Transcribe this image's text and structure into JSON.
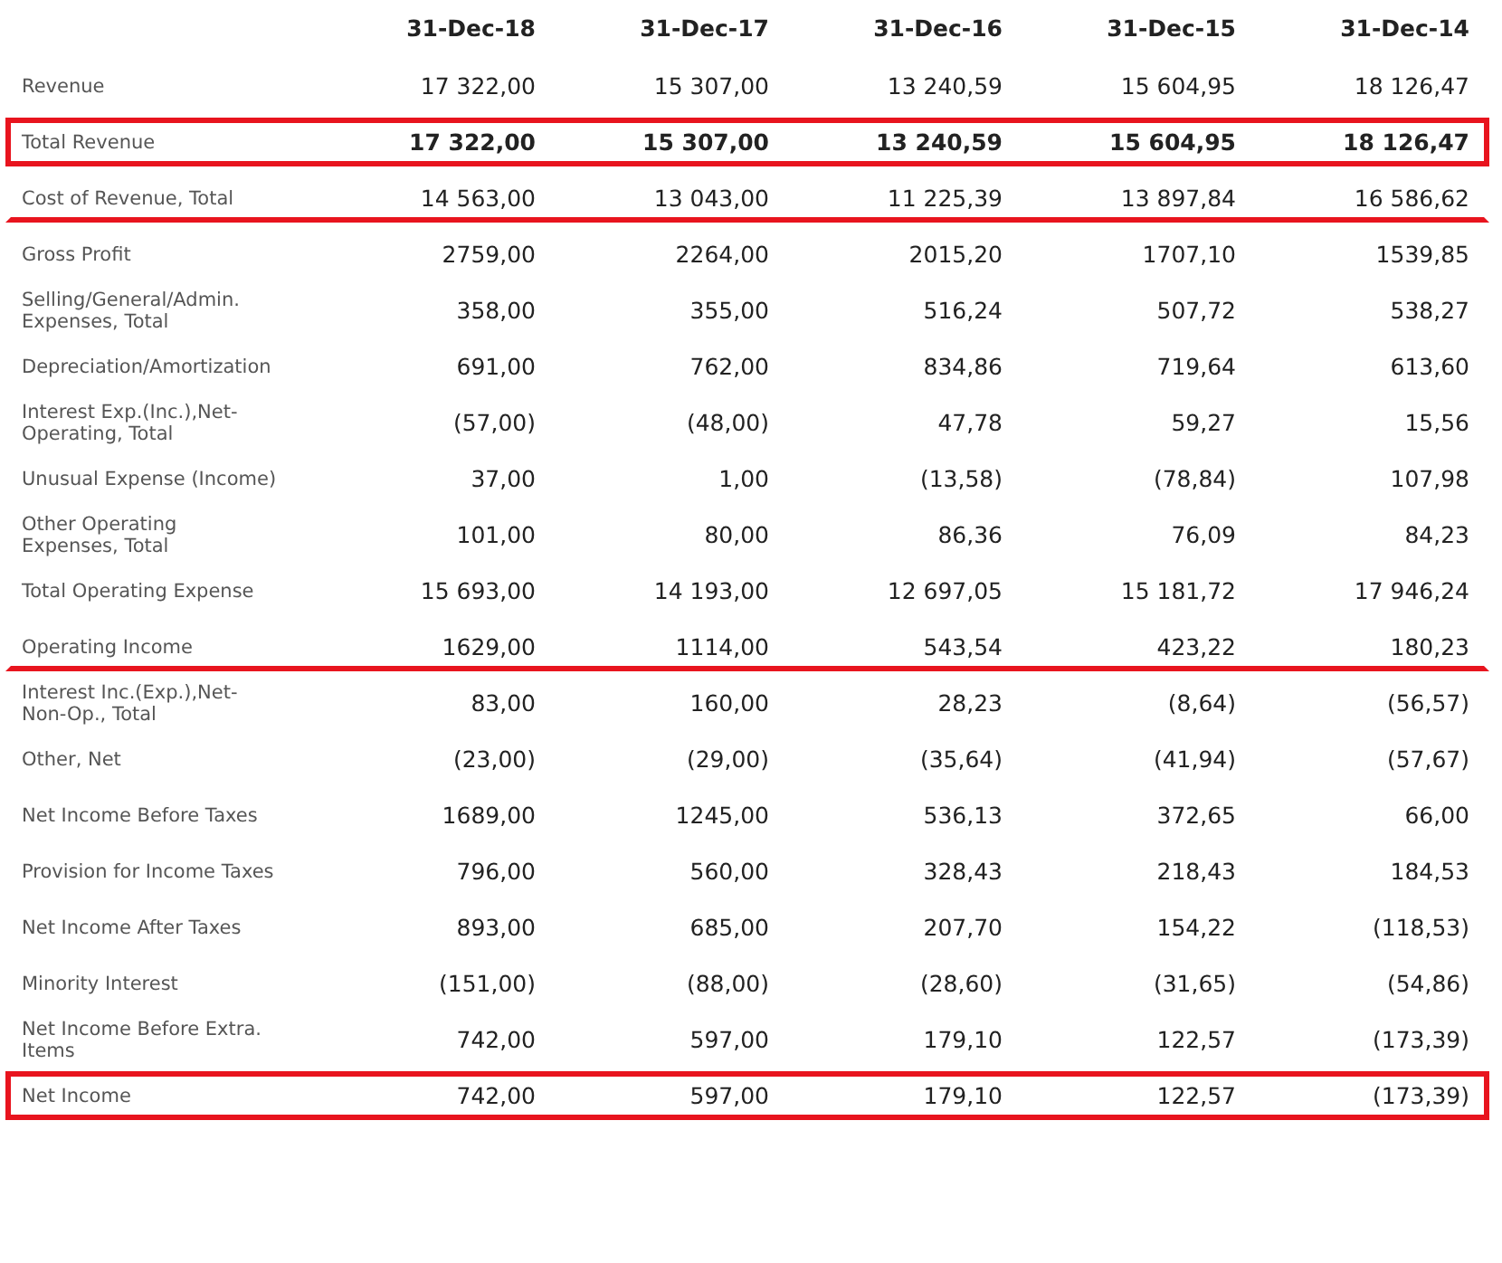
{
  "columns": [
    "31-Dec-18",
    "31-Dec-17",
    "31-Dec-16",
    "31-Dec-15",
    "31-Dec-14"
  ],
  "rows": [
    {
      "label": "Revenue",
      "kind": "plain",
      "values": [
        "17 322,00",
        "15 307,00",
        "13 240,59",
        "15 604,95",
        "18 126,47"
      ]
    },
    {
      "label": "Total Revenue",
      "kind": "total",
      "values": [
        "17 322,00",
        "15 307,00",
        "13 240,59",
        "15 604,95",
        "18 126,47"
      ]
    },
    {
      "label": "Cost of Revenue, Total",
      "kind": "underlined",
      "values": [
        "14 563,00",
        "13 043,00",
        "11 225,39",
        "13 897,84",
        "16 586,62"
      ]
    },
    {
      "label": "Gross Profit",
      "kind": "plain",
      "values": [
        "2759,00",
        "2264,00",
        "2015,20",
        "1707,10",
        "1539,85"
      ]
    },
    {
      "label": "Selling/General/Admin. Expenses, Total",
      "kind": "plain",
      "values": [
        "358,00",
        "355,00",
        "516,24",
        "507,72",
        "538,27"
      ]
    },
    {
      "label": "Depreciation/Amortization",
      "kind": "plain",
      "values": [
        "691,00",
        "762,00",
        "834,86",
        "719,64",
        "613,60"
      ]
    },
    {
      "label": "Interest Exp.(Inc.),Net-Operating, Total",
      "kind": "plain",
      "values": [
        "(57,00)",
        "(48,00)",
        "47,78",
        "59,27",
        "15,56"
      ]
    },
    {
      "label": "Unusual Expense (Income)",
      "kind": "plain",
      "values": [
        "37,00",
        "1,00",
        "(13,58)",
        "(78,84)",
        "107,98"
      ]
    },
    {
      "label": "Other Operating Expenses, Total",
      "kind": "plain",
      "values": [
        "101,00",
        "80,00",
        "86,36",
        "76,09",
        "84,23"
      ]
    },
    {
      "label": "Total Operating Expense",
      "kind": "plain",
      "values": [
        "15 693,00",
        "14 193,00",
        "12 697,05",
        "15 181,72",
        "17 946,24"
      ]
    },
    {
      "label": "Operating Income",
      "kind": "underlined",
      "values": [
        "1629,00",
        "1114,00",
        "543,54",
        "423,22",
        "180,23"
      ]
    },
    {
      "label": "Interest Inc.(Exp.),Net-Non-Op., Total",
      "kind": "plain",
      "values": [
        "83,00",
        "160,00",
        "28,23",
        "(8,64)",
        "(56,57)"
      ]
    },
    {
      "label": "Other, Net",
      "kind": "plain",
      "values": [
        "(23,00)",
        "(29,00)",
        "(35,64)",
        "(41,94)",
        "(57,67)"
      ]
    },
    {
      "label": "Net Income Before Taxes",
      "kind": "plain",
      "values": [
        "1689,00",
        "1245,00",
        "536,13",
        "372,65",
        "66,00"
      ]
    },
    {
      "label": "Provision for Income Taxes",
      "kind": "plain",
      "values": [
        "796,00",
        "560,00",
        "328,43",
        "218,43",
        "184,53"
      ]
    },
    {
      "label": "Net Income After Taxes",
      "kind": "plain",
      "values": [
        "893,00",
        "685,00",
        "207,70",
        "154,22",
        "(118,53)"
      ]
    },
    {
      "label": "Minority Interest",
      "kind": "plain",
      "values": [
        "(151,00)",
        "(88,00)",
        "(28,60)",
        "(31,65)",
        "(54,86)"
      ]
    },
    {
      "label": "Net Income Before Extra. Items",
      "kind": "plain",
      "values": [
        "742,00",
        "597,00",
        "179,10",
        "122,57",
        "(173,39)"
      ]
    },
    {
      "label": "Net Income",
      "kind": "boxed",
      "values": [
        "742,00",
        "597,00",
        "179,10",
        "122,57",
        "(173,39)"
      ]
    }
  ]
}
